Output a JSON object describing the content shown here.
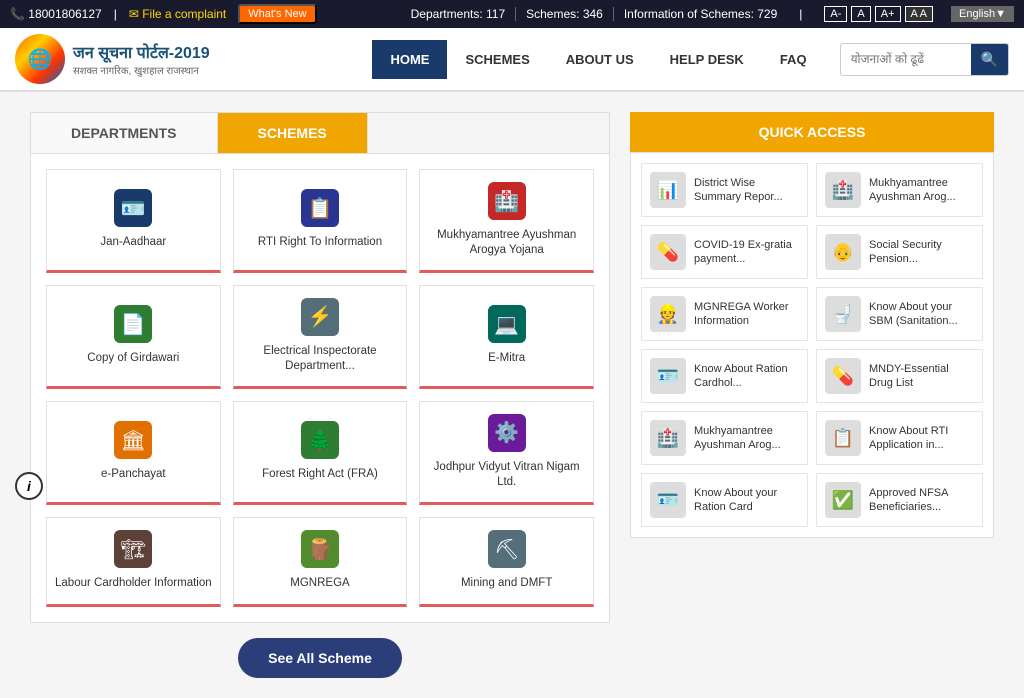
{
  "topbar": {
    "phone": "📞 18001806127",
    "complaint": "✉ File a complaint",
    "whats_new": "What's New",
    "stats": [
      "Departments: 117",
      "Schemes: 346",
      "Information of Schemes: 729"
    ],
    "font_controls": [
      "A-",
      "A",
      "A+"
    ],
    "contrast_label": "A A",
    "lang_label": "English▼"
  },
  "nav": {
    "logo_title": "जन सूचना पोर्टल-2019",
    "logo_subtitle": "सशक्त नागरिक, खुशहाल राजस्थान",
    "links": [
      "HOME",
      "SCHEMES",
      "ABOUT US",
      "HELP DESK",
      "FAQ"
    ],
    "search_placeholder": "योजनाओं को ढूढें",
    "active_link": "HOME"
  },
  "tabs": {
    "departments_label": "DEPARTMENTS",
    "schemes_label": "SCHEMES"
  },
  "departments": [
    {
      "label": "Jan-Aadhaar",
      "icon": "🪪",
      "bg": "bg-blue"
    },
    {
      "label": "RTI Right To Information",
      "icon": "📋",
      "bg": "bg-indigo"
    },
    {
      "label": "Mukhyamantree Ayushman Arogya Yojana",
      "icon": "🏥",
      "bg": "bg-red"
    },
    {
      "label": "Copy of Girdawari",
      "icon": "📄",
      "bg": "bg-green"
    },
    {
      "label": "Electrical Inspectorate Department...",
      "icon": "⚡",
      "bg": "bg-gray"
    },
    {
      "label": "E-Mitra",
      "icon": "💻",
      "bg": "bg-teal"
    },
    {
      "label": "e-Panchayat",
      "icon": "🏛",
      "bg": "bg-orange"
    },
    {
      "label": "Forest Right Act (FRA)",
      "icon": "🌲",
      "bg": "bg-green"
    },
    {
      "label": "Jodhpur Vidyut Vitran Nigam Ltd.",
      "icon": "⚙️",
      "bg": "bg-purple"
    },
    {
      "label": "Labour Cardholder Information",
      "icon": "🏗",
      "bg": "bg-brown"
    },
    {
      "label": "MGNREGA",
      "icon": "🪵",
      "bg": "bg-lime"
    },
    {
      "label": "Mining and DMFT",
      "icon": "⛏",
      "bg": "bg-gray"
    }
  ],
  "quick_access": {
    "title": "QUICK ACCESS",
    "items": [
      {
        "label": "District Wise Summary Repor...",
        "icon": "📊",
        "bg": "bg-blue"
      },
      {
        "label": "Mukhyamantree Ayushman Arog...",
        "icon": "🏥",
        "bg": "bg-red"
      },
      {
        "label": "COVID-19 Ex-gratia payment...",
        "icon": "💊",
        "bg": "bg-teal"
      },
      {
        "label": "Social Security Pension...",
        "icon": "👴",
        "bg": "bg-green"
      },
      {
        "label": "MGNREGA Worker Information",
        "icon": "👷",
        "bg": "bg-orange"
      },
      {
        "label": "Know About your SBM (Sanitation...",
        "icon": "🚽",
        "bg": "bg-indigo"
      },
      {
        "label": "Know About Ration Cardhol...",
        "icon": "🪪",
        "bg": "bg-purple"
      },
      {
        "label": "MNDY-Essential Drug List",
        "icon": "💊",
        "bg": "bg-red"
      },
      {
        "label": "Mukhyamantree Ayushman Arog...",
        "icon": "🏥",
        "bg": "bg-red"
      },
      {
        "label": "Know About RTI Application in...",
        "icon": "📋",
        "bg": "bg-blue"
      },
      {
        "label": "Know About your Ration Card",
        "icon": "🪪",
        "bg": "bg-orange"
      },
      {
        "label": "Approved NFSA Beneficiaries...",
        "icon": "✅",
        "bg": "bg-green"
      }
    ]
  },
  "see_all_btn": "See All Scheme",
  "info_icon": "i"
}
